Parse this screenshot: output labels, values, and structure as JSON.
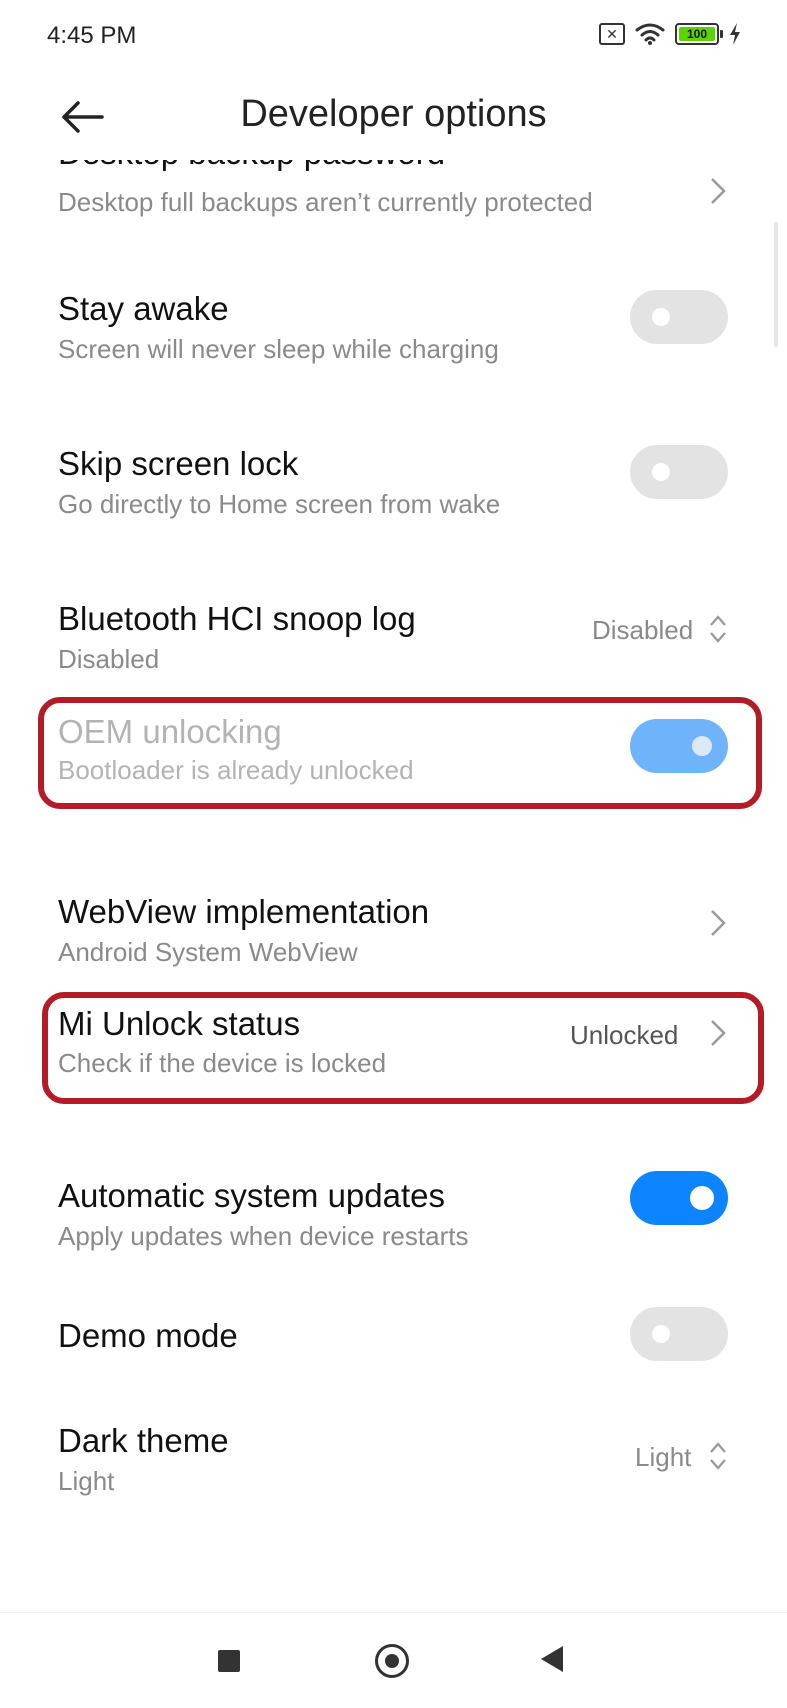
{
  "status_bar": {
    "time": "4:45 PM",
    "battery_level": "100",
    "icons": [
      "sim-error-icon",
      "wifi-icon",
      "battery-icon",
      "charging-bolt-icon"
    ]
  },
  "header": {
    "title": "Developer options",
    "back_icon": "back-arrow-icon"
  },
  "settings": [
    {
      "id": "desktop-backup-password",
      "title": "Desktop backup password",
      "subtitle": "Desktop full backups aren’t currently protected",
      "control": "chevron"
    },
    {
      "id": "stay-awake",
      "title": "Stay awake",
      "subtitle": "Screen will never sleep while charging",
      "control": "toggle",
      "state": "off"
    },
    {
      "id": "skip-screen-lock",
      "title": "Skip screen lock",
      "subtitle": "Go directly to Home screen from wake",
      "control": "toggle",
      "state": "off"
    },
    {
      "id": "bluetooth-hci-snoop-log",
      "title": "Bluetooth HCI snoop log",
      "subtitle": "Disabled",
      "control": "dropdown",
      "value": "Disabled"
    },
    {
      "id": "oem-unlocking",
      "title": "OEM unlocking",
      "subtitle": "Bootloader is already unlocked",
      "control": "toggle",
      "state": "on",
      "enabled": false,
      "highlighted": true
    },
    {
      "id": "webview-implementation",
      "title": "WebView implementation",
      "subtitle": "Android System WebView",
      "control": "chevron"
    },
    {
      "id": "mi-unlock-status",
      "title": "Mi Unlock status",
      "subtitle": "Check if the device is locked",
      "control": "chevron",
      "value": "Unlocked",
      "highlighted": true
    },
    {
      "id": "automatic-system-updates",
      "title": "Automatic system updates",
      "subtitle": "Apply updates when device restarts",
      "control": "toggle",
      "state": "on"
    },
    {
      "id": "demo-mode",
      "title": "Demo mode",
      "control": "toggle",
      "state": "off"
    },
    {
      "id": "dark-theme",
      "title": "Dark theme",
      "subtitle": "Light",
      "control": "dropdown",
      "value": "Light"
    }
  ],
  "colors": {
    "accent": "#0d84ff",
    "toggle_off": "#e3e3e3",
    "toggle_disabled_on": "#6fb3fa",
    "highlight_border": "#b31b27",
    "subtitle": "#8a8a8a"
  },
  "nav_bar": {
    "buttons": [
      "recents-square-icon",
      "home-circle-icon",
      "back-triangle-icon"
    ]
  }
}
